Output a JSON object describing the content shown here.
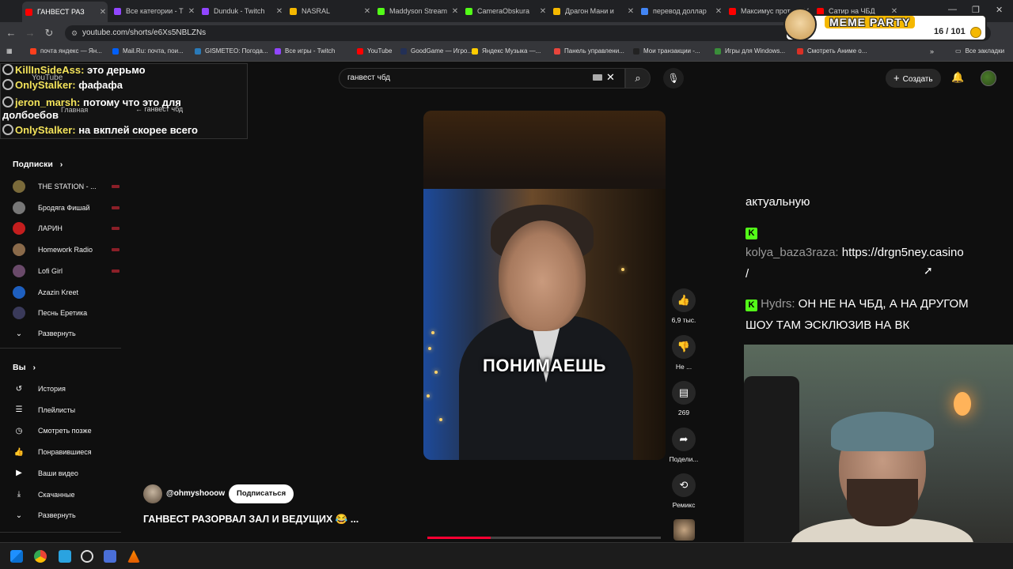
{
  "browser": {
    "tabs": [
      {
        "label": "ГАНВЕСТ РАЗ",
        "active": true,
        "color": "#ff0000"
      },
      {
        "label": "Все категории - T",
        "active": false,
        "color": "#9146ff"
      },
      {
        "label": "Dunduk - Twitch",
        "active": false,
        "color": "#9146ff"
      },
      {
        "label": "NASRAL",
        "active": false,
        "color": "#f5b800"
      },
      {
        "label": "Maddyson Stream",
        "active": false,
        "color": "#53fc18"
      },
      {
        "label": "CameraObskura",
        "active": false,
        "color": "#53fc18"
      },
      {
        "label": "Драгон Мани и",
        "active": false,
        "color": "#f5b800"
      },
      {
        "label": "перевод доллар",
        "active": false,
        "color": "#4285f4"
      },
      {
        "label": "Максимус прот",
        "active": false,
        "color": "#ff0000"
      },
      {
        "label": "Сатир на ЧБД",
        "active": false,
        "color": "#ff0000"
      }
    ],
    "url": "youtube.com/shorts/e6Xs5NBLZNs",
    "bookmarks": [
      {
        "label": "почта яндекс — Ян...",
        "color": "#fc3f1d"
      },
      {
        "label": "Mail.Ru: почта, пои...",
        "color": "#005ff9"
      },
      {
        "label": "GISMETEO: Погода...",
        "color": "#2a7ab8"
      },
      {
        "label": "Все игры - Twitch",
        "color": "#9146ff"
      },
      {
        "label": "YouTube",
        "color": "#ff0000"
      },
      {
        "label": "GoodGame — Игро...",
        "color": "#233056"
      },
      {
        "label": "Яндекс Музыка —...",
        "color": "#ffcc00"
      },
      {
        "label": "Панель управлени...",
        "color": "#e8453c"
      },
      {
        "label": "Мои транзакции -...",
        "color": "#222222"
      },
      {
        "label": "Игры для Windows...",
        "color": "#3a8e3a"
      },
      {
        "label": "Смотреть Аниме о...",
        "color": "#d93025"
      }
    ],
    "all_bookmarks": "Все закладки"
  },
  "youtube": {
    "search_value": "ганвест чбд",
    "create_label": "Создать",
    "sidebar": {
      "subs_title": "Подписки",
      "subs": [
        {
          "label": "THE STATION - ...",
          "live": true,
          "color": "#7a6a3a",
          "icon": "channel-avatar-icon"
        },
        {
          "label": "Бродяга Фишай",
          "live": true,
          "color": "#777777",
          "icon": "channel-avatar-icon"
        },
        {
          "label": "ЛАРИН",
          "live": true,
          "color": "#c41e1e",
          "icon": "channel-avatar-icon"
        },
        {
          "label": "Homework Radio",
          "live": true,
          "color": "#8a6a4a",
          "icon": "channel-avatar-icon"
        },
        {
          "label": "Lofi Girl",
          "live": true,
          "color": "#6a4a6a",
          "icon": "channel-avatar-icon"
        },
        {
          "label": "Azazin Kreet",
          "live": false,
          "color": "#1e5fbf",
          "icon": "channel-avatar-icon"
        },
        {
          "label": "Песнь Еретика",
          "live": false,
          "color": "#3a3a5a",
          "icon": "channel-avatar-icon"
        }
      ],
      "expand_label": "Развернуть",
      "you_title": "Вы",
      "you_items": [
        {
          "label": "История",
          "glyph": "↺",
          "icon": "history-icon"
        },
        {
          "label": "Плейлисты",
          "glyph": "☰",
          "icon": "playlists-icon"
        },
        {
          "label": "Смотреть позже",
          "glyph": "◷",
          "icon": "watch-later-icon"
        },
        {
          "label": "Понравившиеся",
          "glyph": "👍",
          "icon": "liked-icon"
        },
        {
          "label": "Ваши видео",
          "glyph": "▶",
          "icon": "your-videos-icon"
        },
        {
          "label": "Скачанные",
          "glyph": "⤓",
          "icon": "downloads-icon"
        }
      ],
      "expand2_label": "Развернуть"
    },
    "ghost": {
      "home": "Главная",
      "back_search": "ганвест чбд",
      "logo": "YouTube"
    },
    "short": {
      "caption": "ПОНИМАЕШЬ",
      "channel": "@ohmyshooow",
      "subscribe_label": "Подписаться",
      "title": "ГАНВЕСТ РАЗОРВАЛ ЗАЛ И ВЕДУЩИХ 😂 ...",
      "progress": 0.27
    },
    "actions": {
      "likes": "6,9 тыс.",
      "dislike": "Не ...",
      "comments": "269",
      "share": "Подели...",
      "remix": "Ремикс"
    }
  },
  "stream_overlay": {
    "top_chat": [
      {
        "user": "KillInSideAss:",
        "msg": " это дерьмо"
      },
      {
        "user": "OnlyStalker:",
        "msg": " фафафа"
      },
      {
        "user": "jeron_marsh:",
        "msg": " потому что это для"
      },
      {
        "user": "",
        "msg": "долбоебов"
      },
      {
        "user": "OnlyStalker:",
        "msg": " на вкплей скорее всего"
      }
    ],
    "right_chat": {
      "line1": "актуальную",
      "user2": "kolya_baza3raza:",
      "msg2a": " https://drgn5ney.casino",
      "msg2b": "/",
      "user3": "Hydrs:",
      "msg3a": " ОН НЕ НА ЧБД, А НА ДРУГОМ",
      "msg3b": "ШОУ ТАМ ЭСКЛЮЗИВ НА ВК"
    },
    "meme_party": {
      "title": "MEME PARTY",
      "count": "16 / 101"
    }
  }
}
